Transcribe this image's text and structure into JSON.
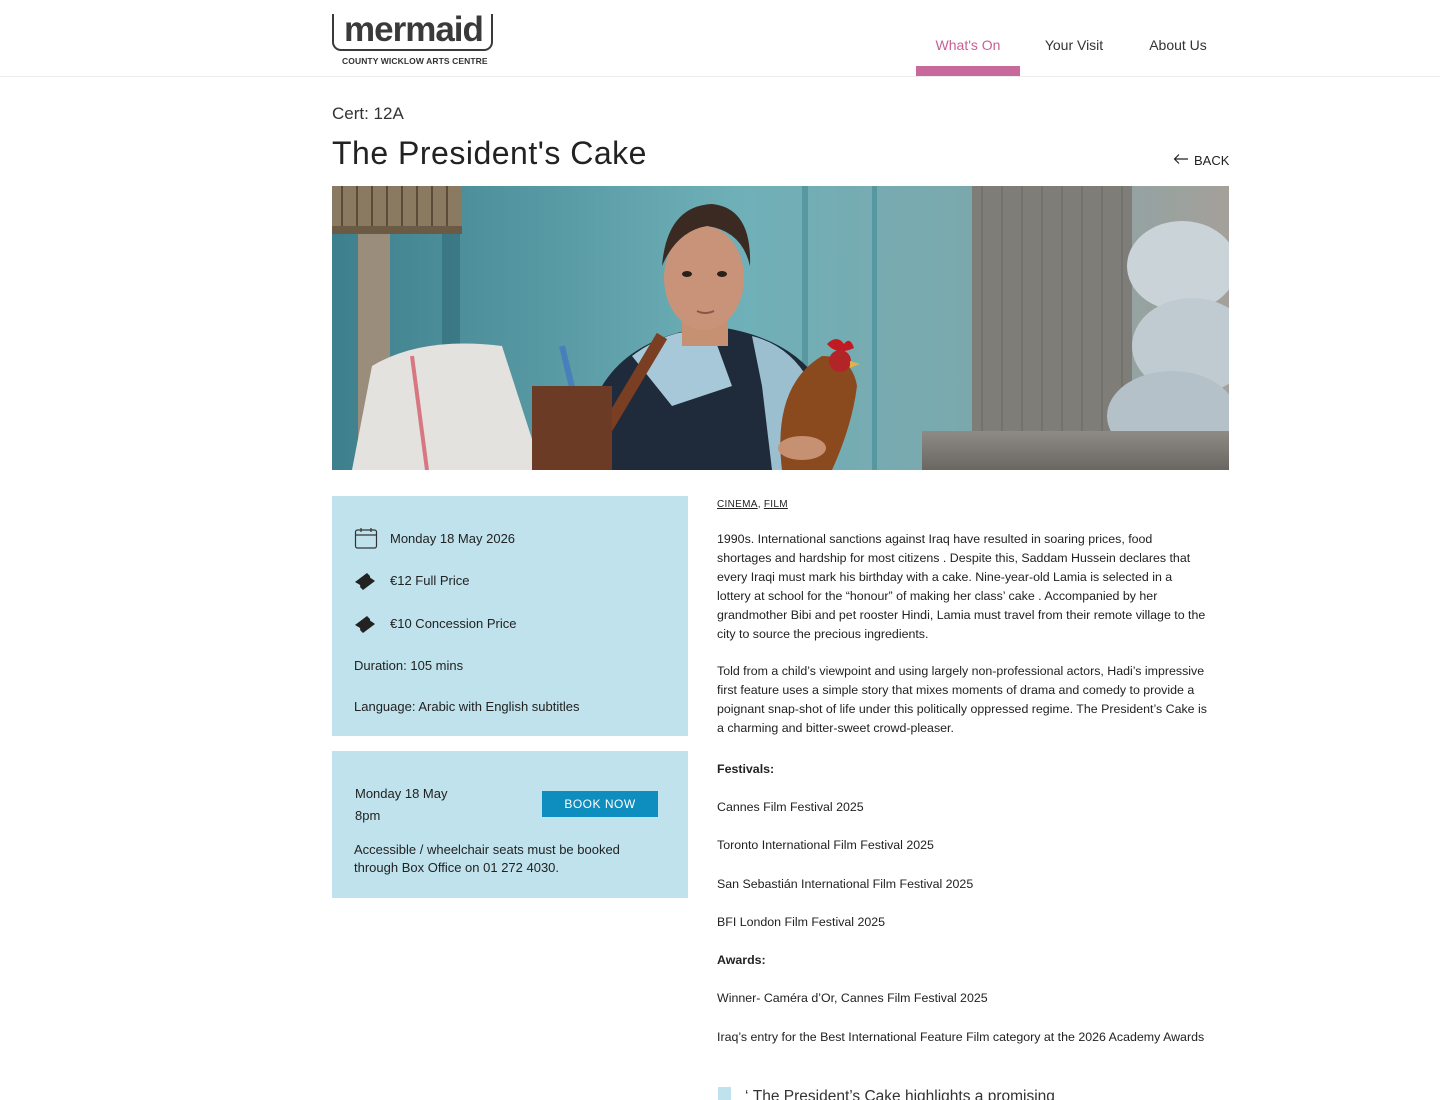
{
  "header": {
    "logo_word": "mermaid",
    "logo_sub": "COUNTY WICKLOW ARTS CENTRE",
    "nav": [
      {
        "label": "What's On",
        "active": true
      },
      {
        "label": "Your Visit",
        "active": false
      },
      {
        "label": "About Us",
        "active": false
      }
    ],
    "accent_color": "#c8699b"
  },
  "film": {
    "cert": "Cert: 12A",
    "title": "The President's Cake",
    "back_label": "BACK"
  },
  "info": {
    "date": "Monday 18 May 2026",
    "full_price": "€12 Full Price",
    "concession_price": "€10 Concession Price",
    "duration": "Duration: 105 mins",
    "language": "Language: Arabic with English subtitles",
    "icons": [
      "calendar-icon",
      "ticket-icon",
      "ticket-icon"
    ]
  },
  "booking": {
    "day": "Monday 18 May",
    "time": "8pm",
    "button_label": "BOOK NOW",
    "note": "Accessible / wheelchair seats must be booked through Box Office on 01 272 4030.",
    "button_color": "#0e8dbf",
    "panel_color": "#bfe2ec"
  },
  "tags": [
    "CINEMA",
    "FILM"
  ],
  "description": {
    "p1": "1990s. International sanctions against Iraq have resulted in soaring prices, food shortages and hardship for most citizens . Despite this, Saddam Hussein declares that every Iraqi must mark his birthday with a cake. Nine-year-old Lamia is selected in a lottery at school for the “honour” of making her class’ cake . Accompanied by her grandmother Bibi and pet rooster Hindi, Lamia must travel from their remote village to the city to source the precious ingredients.",
    "p2": "Told from a child’s viewpoint and using largely non-professional actors, Hadi’s impressive first feature uses a simple story that mixes moments of drama and comedy to provide a poignant snap-shot of life under this politically oppressed regime. The President’s Cake is a charming and bitter-sweet crowd-pleaser.",
    "festivals_heading": "Festivals:",
    "festivals": [
      "Cannes Film Festival 2025",
      "Toronto International Film Festival 2025",
      "San Sebastián International Film Festival 2025",
      "BFI London Film Festival 2025"
    ],
    "awards_heading": "Awards:",
    "awards": [
      "Winner- Caméra d’Or, Cannes Film Festival 2025",
      "Iraq’s entry for the Best International Feature Film category at the 2026 Academy Awards"
    ]
  },
  "quote": {
    "mark": "‘",
    "text": "The President’s Cake highlights a promising"
  }
}
